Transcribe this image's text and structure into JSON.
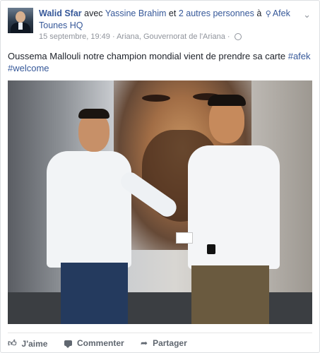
{
  "post": {
    "author": "Walid Sfar",
    "with_text": "avec",
    "tagged_person": "Yassine Brahim",
    "and_text": "et",
    "others": "2 autres personnes",
    "at_text": "à",
    "place": "Afek Tounes HQ",
    "date": "15 septembre, 19:49",
    "location": "Ariana, Gouvernorat de l'Ariana",
    "separator": "·",
    "text": "Oussema Mallouli notre champion mondial vient de prendre sa carte",
    "hashtags": [
      "#afek",
      "#welcome"
    ]
  },
  "actions": {
    "like_label": "J'aime",
    "comment_label": "Commenter",
    "share_label": "Partager"
  },
  "icons": {
    "avatar": "profile-photo",
    "pin": "map-pin-icon",
    "globe": "globe-icon",
    "chevron": "chevron-down-icon",
    "like": "thumbs-up-icon",
    "comment": "comment-bubble-icon",
    "share": "share-arrow-icon"
  },
  "colors": {
    "link": "#365899",
    "meta": "#90949c",
    "action": "#606770"
  }
}
